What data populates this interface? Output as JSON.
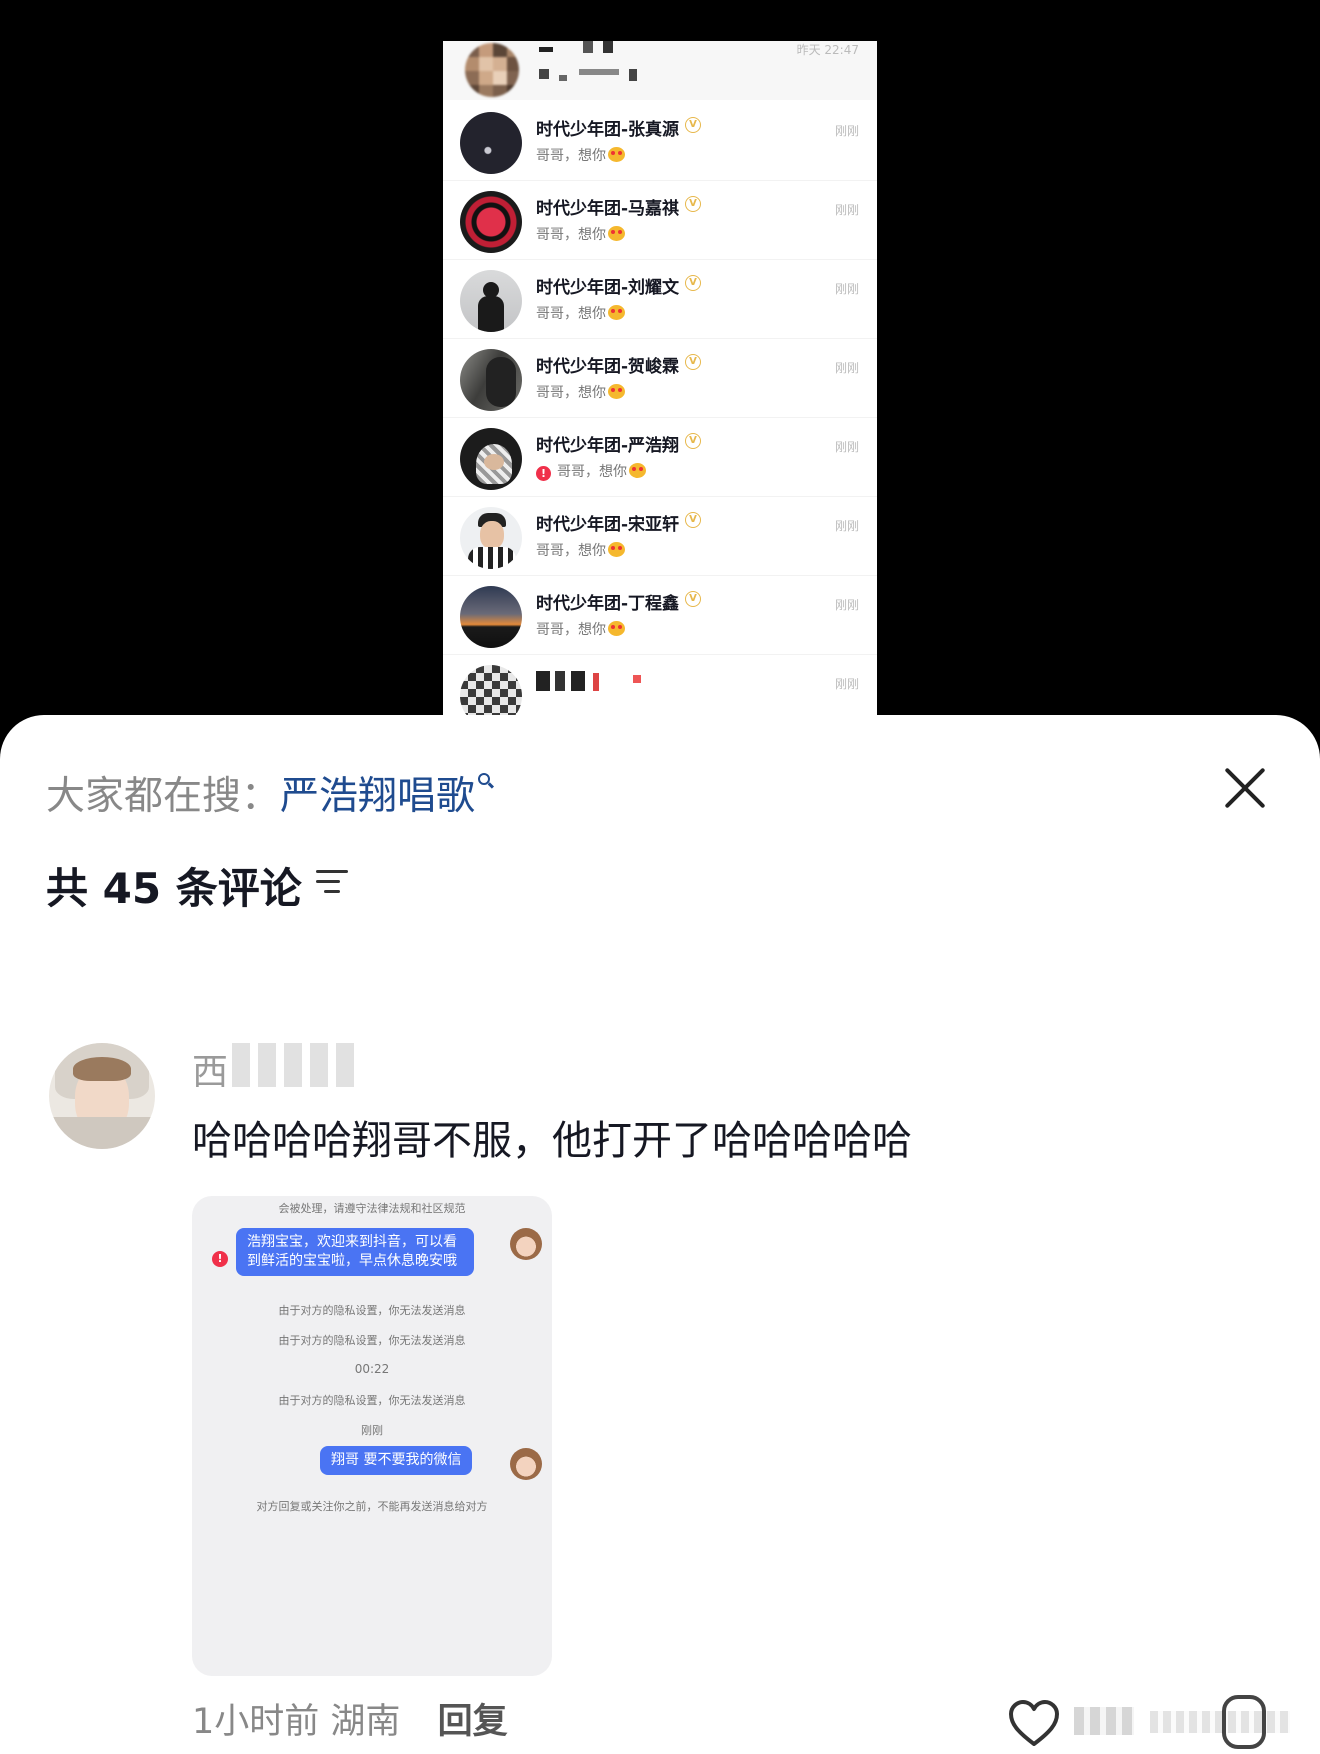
{
  "top_screenshot": {
    "first_row_time": "昨天 22:47",
    "conversations": [
      {
        "name": "时代少年团-张真源",
        "message": "哥哥，想你",
        "time": "刚刚",
        "alert": false
      },
      {
        "name": "时代少年团-马嘉祺",
        "message": "哥哥，想你",
        "time": "刚刚",
        "alert": false
      },
      {
        "name": "时代少年团-刘耀文",
        "message": "哥哥，想你",
        "time": "刚刚",
        "alert": false
      },
      {
        "name": "时代少年团-贺峻霖",
        "message": "哥哥，想你",
        "time": "刚刚",
        "alert": false
      },
      {
        "name": "时代少年团-严浩翔",
        "message": "哥哥，想你",
        "time": "刚刚",
        "alert": true
      },
      {
        "name": "时代少年团-宋亚轩",
        "message": "哥哥，想你",
        "time": "刚刚",
        "alert": false
      },
      {
        "name": "时代少年团-丁程鑫",
        "message": "哥哥，想你",
        "time": "刚刚",
        "alert": false
      }
    ],
    "last_row_time": "刚刚",
    "verified_mark": "V",
    "alert_mark": "!"
  },
  "panel": {
    "search_prefix": "大家都在搜：",
    "search_keyword": "严浩翔唱歌",
    "comment_count_label": "共 45 条评论"
  },
  "comment": {
    "username_visible": "西",
    "text": "哈哈哈哈翔哥不服，他打开了哈哈哈哈哈",
    "image": {
      "notice_top": "会被处理，请遵守法律法规和社区规范",
      "bubble1": "浩翔宝宝，欢迎来到抖音，可以看到鲜活的宝宝啦，早点休息晚安哦",
      "sys1": "由于对方的隐私设置，你无法发送消息",
      "sys2": "由于对方的隐私设置，你无法发送消息",
      "time1": "00:22",
      "sys3": "由于对方的隐私设置，你无法发送消息",
      "time2": "刚刚",
      "bubble2": "翔哥 要不要我的微信",
      "notice_bottom": "对方回复或关注你之前，不能再发送消息给对方"
    },
    "meta_time": "1小时前",
    "meta_location": "湖南",
    "reply_label": "回复"
  }
}
